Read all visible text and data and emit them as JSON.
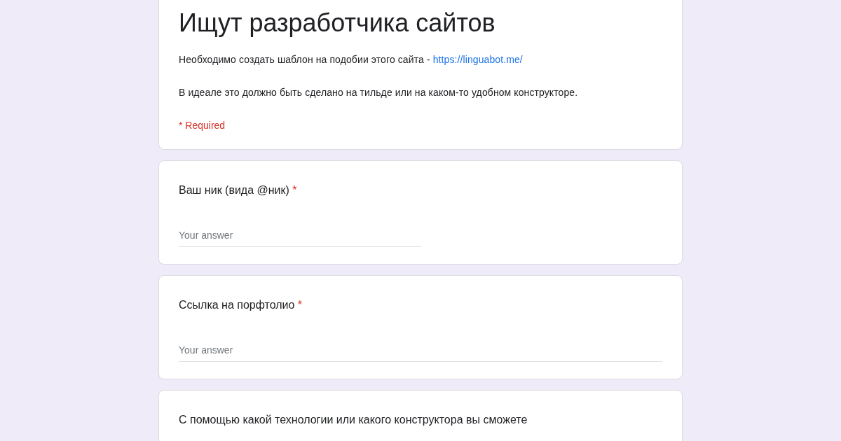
{
  "form": {
    "title": "Ищут разработчика сайтов",
    "description": [
      {
        "text": "Необходимо создать шаблон на подобии этого сайта - ",
        "link": "https://linguabot.me/"
      },
      {
        "text": "В идеале это должно быть сделано на тильде или на каком-то удобном конструкторе."
      }
    ],
    "required_note": "* Required"
  },
  "questions": [
    {
      "label": "Ваш ник (вида @ник)",
      "required_mark": "*",
      "answer": {
        "kind": "short",
        "placeholder": "Your answer"
      }
    },
    {
      "label": "Ссылка на порфтолио",
      "required_mark": "*",
      "answer": {
        "kind": "long",
        "placeholder": "Your answer"
      }
    },
    {
      "label": "С помощью какой технологии или какого конструктора вы сможете"
    }
  ]
}
